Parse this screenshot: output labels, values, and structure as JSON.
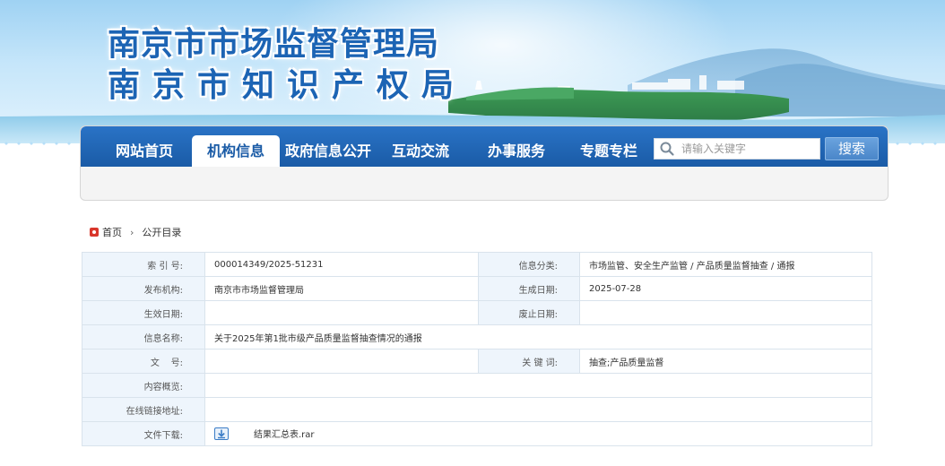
{
  "header": {
    "title_line1": "南京市市场监督管理局",
    "title_line2": "南京市知识产权局"
  },
  "nav": {
    "items": [
      {
        "label": "网站首页"
      },
      {
        "label": "机构信息",
        "active": true
      },
      {
        "label": "政府信息公开"
      },
      {
        "label": "互动交流"
      },
      {
        "label": "办事服务"
      },
      {
        "label": "专题专栏"
      }
    ],
    "search_placeholder": "请输入关键字",
    "search_button": "搜索"
  },
  "breadcrumb": {
    "home": "首页",
    "current": "公开目录"
  },
  "info": {
    "index_label": "索 引 号:",
    "index_value": "000014349/2025-51231",
    "category_label": "信息分类:",
    "category_value": "市场监管、安全生产监管 / 产品质量监督抽查 / 通报",
    "publisher_label": "发布机构:",
    "publisher_value": "南京市市场监督管理局",
    "created_label": "生成日期:",
    "created_value": "2025-07-28",
    "effective_label": "生效日期:",
    "effective_value": "",
    "expiry_label": "废止日期:",
    "expiry_value": "",
    "name_label": "信息名称:",
    "name_value": "关于2025年第1批市级产品质量监督抽查情况的通报",
    "doc_no_label": "文    号:",
    "doc_no_value": "",
    "keywords_label": "关 键 词:",
    "keywords_value": "抽查;产品质量监督",
    "summary_label": "内容概览:",
    "summary_value": "",
    "online_link_label": "在线链接地址:",
    "online_link_value": "",
    "download_label": "文件下载:",
    "download_file": "结果汇总表.rar"
  },
  "colors": {
    "nav_blue": "#1a5ba6",
    "title_blue": "#1c64b4",
    "label_bg": "#eef5fc",
    "border": "#d9e3ec",
    "home_icon_red": "#d9362b"
  }
}
